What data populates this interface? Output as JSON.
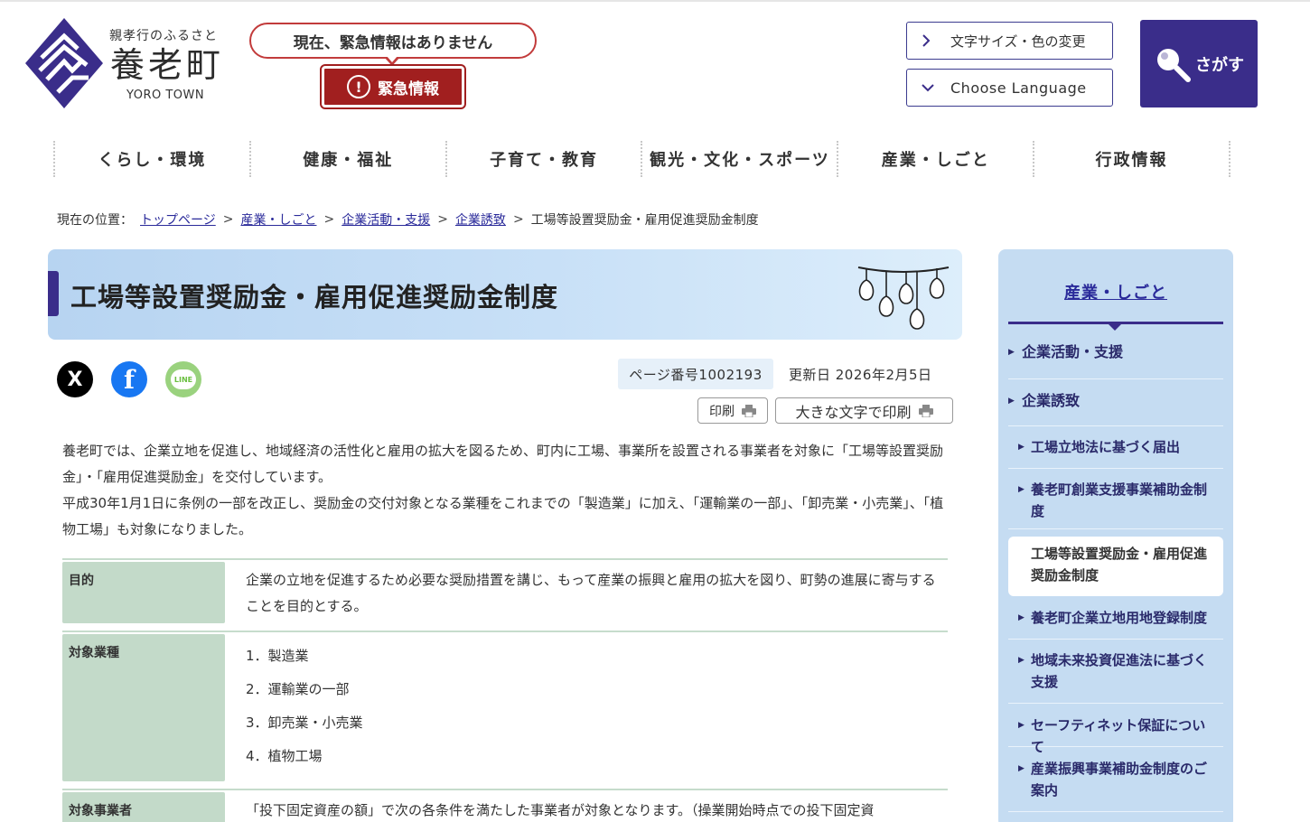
{
  "header": {
    "tagline": "親孝行のふるさと",
    "town_name": "養老町",
    "town_name_en": "YORO TOWN",
    "emergency_status": "現在、緊急情報はありません",
    "emergency_button": "緊急情報",
    "emergency_icon": "!",
    "font_color_button": "文字サイズ・色の変更",
    "language_button": "Choose Language",
    "search_button": "さがす"
  },
  "nav": [
    {
      "label": "くらし・環境"
    },
    {
      "label": "健康・福祉"
    },
    {
      "label": "子育て・教育"
    },
    {
      "label": "観光・文化・スポーツ"
    },
    {
      "label": "産業・しごと"
    },
    {
      "label": "行政情報"
    }
  ],
  "breadcrumb": {
    "prefix": "現在の位置：",
    "links": [
      "トップページ",
      "産業・しごと",
      "企業活動・支援",
      "企業誘致"
    ],
    "separator": ">",
    "current": "工場等設置奨励金・雇用促進奨励金制度"
  },
  "page": {
    "title": "工場等設置奨励金・雇用促進奨励金制度",
    "page_number": "ページ番号1002193",
    "updated": "更新日 2026年2月5日",
    "print_label": "印刷",
    "print_large_label": "大きな文字で印刷",
    "sns_x_label": "X",
    "sns_fb_label": "f",
    "sns_line_label": "LINE",
    "intro_1": "養老町では、企業立地を促進し、地域経済の活性化と雇用の拡大を図るため、町内に工場、事業所を設置される事業者を対象に「工場等設置奨励金」・「雇用促進奨励金」を交付しています。",
    "intro_2": "平成30年1月1日に条例の一部を改正し、奨励金の交付対象となる業種をこれまでの「製造業」に加え、「運輸業の一部」、「卸売業・小売業」、「植物工場」も対象になりました。"
  },
  "table": {
    "purpose_head": "目的",
    "purpose_body": "企業の立地を促進するため必要な奨励措置を講じ、もって産業の振興と雇用の拡大を図り、町勢の進展に寄与することを目的とする。",
    "industry_head": "対象業種",
    "industries": [
      "1．製造業",
      "2．運輸業の一部",
      "3．卸売業・小売業",
      "4．植物工場"
    ],
    "operator_head": "対象事業者",
    "operator_body": "「投下固定資産の額」で次の各条件を満たした事業者が対象となります。（操業開始時点での投下固定資"
  },
  "sidebar": {
    "title": "産業・しごと",
    "items": [
      {
        "label": "企業活動・支援"
      },
      {
        "label": "企業誘致"
      },
      {
        "label": "工場立地法に基づく届出"
      },
      {
        "label": "養老町創業支援事業補助金制度"
      },
      {
        "label": "工場等設置奨励金・雇用促進奨励金制度"
      },
      {
        "label": "養老町企業立地用地登録制度"
      },
      {
        "label": "地域未来投資促進法に基づく支援"
      },
      {
        "label": "セーフティネット保証について"
      },
      {
        "label": "産業振興事業補助金制度のご案内"
      }
    ]
  },
  "colors": {
    "brand": "#3a2d8a",
    "emergency": "#a11f1f",
    "banner": "#c8e0f7",
    "table_head": "#c3dac9",
    "sidebar_bg": "#c5dcf2"
  }
}
